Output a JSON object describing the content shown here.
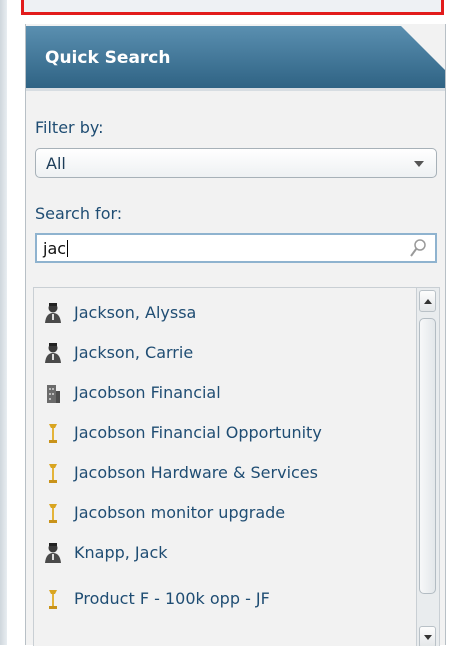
{
  "panel": {
    "title": "Quick Search",
    "filter_label": "Filter by:",
    "filter_value": "All",
    "search_label": "Search for:",
    "search_value": "jac"
  },
  "results": [
    {
      "label": "Jackson, Alyssa",
      "icon": "contact-icon"
    },
    {
      "label": "Jackson, Carrie",
      "icon": "contact-icon"
    },
    {
      "label": "Jacobson Financial",
      "icon": "account-icon"
    },
    {
      "label": "Jacobson Financial Opportunity",
      "icon": "opportunity-icon"
    },
    {
      "label": "Jacobson Hardware & Services",
      "icon": "opportunity-icon"
    },
    {
      "label": "Jacobson monitor upgrade",
      "icon": "opportunity-icon"
    },
    {
      "label": "Knapp, Jack",
      "icon": "contact-icon"
    },
    {
      "label": "Product F - 100k opp - JF",
      "icon": "opportunity-icon"
    }
  ],
  "colors": {
    "header_bg": "#3e7394",
    "label_text": "#1f4d73",
    "highlight_border": "#e21b1b"
  }
}
